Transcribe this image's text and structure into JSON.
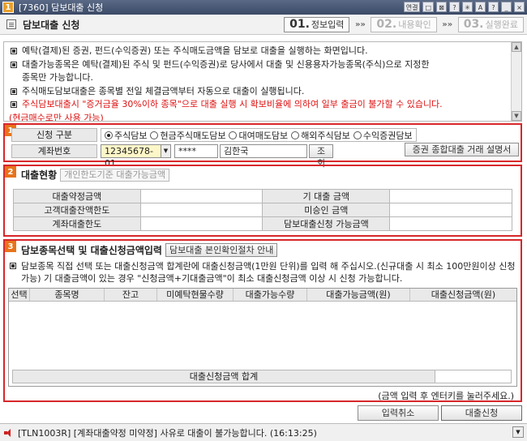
{
  "window": {
    "number": "1",
    "title": "[7360] 담보대출 신청",
    "controls": [
      "연결",
      "□",
      "⊠",
      "?",
      "✳",
      "A",
      "?",
      "_",
      "×"
    ]
  },
  "header": {
    "page_title": "담보대출 신청",
    "steps": [
      {
        "num": "01.",
        "label": "정보입력"
      },
      {
        "num": "02.",
        "label": "내용확인"
      },
      {
        "num": "03.",
        "label": "실행완료"
      }
    ],
    "step_separator": "»»"
  },
  "notice": {
    "lines": [
      "예탁(결제)된 증권, 펀드(수익증권) 또는 주식매도금액을 담보로 대출을 실행하는 화면입니다.",
      "대출가능종목은 예탁(결제)된 주식 및 펀드(수익증권)로 당사에서 대출 및 신용용자가능종목(주식)으로 지정한",
      "종목만 가능합니다.",
      "주식매도담보대출은 종목별 전일 체결금액부터 자동으로 대출이 실행됩니다.",
      "주식담보대출시 \"증거금율 30%이하 종목\"으로 대출 실행 시 확보비율에 의하여 일부 출금이 불가할 수 있습니다.",
      "(현금매수로만 사용 가능)"
    ]
  },
  "section1": {
    "badge": "1",
    "type_label": "신청 구분",
    "types": [
      "주식담보",
      "현금주식매도담보",
      "대여매도담보",
      "해외주식담보",
      "수익증권담보"
    ],
    "account_label": "계좌번호",
    "account_value": "12345678-01",
    "password_value": "****",
    "holder_name": "김한국",
    "lookup_button": "조회",
    "explain_button": "증권 종합대출 거래 설명서"
  },
  "section2": {
    "badge": "2",
    "title": "대출현황",
    "tab_label": "개인한도기준 대출가능금액",
    "rows": [
      [
        "대출약정금액",
        "",
        "기 대출 금액",
        ""
      ],
      [
        "고객대출잔액한도",
        "",
        "미승인 금액",
        ""
      ],
      [
        "계좌대출한도",
        "",
        "담보대출신청 가능금액",
        ""
      ]
    ]
  },
  "section3": {
    "badge": "3",
    "title": "담보종목선택 및 대출신청금액입력",
    "guide_button": "담보대출 본인확인절차 안내",
    "guide_text": "담보종목 직접 선택 또는 대출신청금액 합계란에 대출신청금액(1만원 단위)를 입력 해 주십시오.(신규대출 시 최소 100만원이상 신청가능) 기 대출금액이 있는 경우 \"신청금액+기대출금액\"이 최소 대출신청금액 이상 시 신청 가능합니다.",
    "columns": [
      "선택",
      "종목명",
      "잔고",
      "미예탁현물수량",
      "대출가능수량",
      "대출가능금액(원)",
      "대출신청금액(원)"
    ],
    "total_label": "대출신청금액 합계",
    "total_value": "",
    "enter_note": "(금액 입력 후 엔터키를 눌러주세요.)"
  },
  "actions": {
    "cancel": "입력취소",
    "apply": "대출신청"
  },
  "status": {
    "message": "[TLN1003R] [계좌대출약정 미약정] 사유로 대출이 불가능합니다. (16:13:25)"
  }
}
